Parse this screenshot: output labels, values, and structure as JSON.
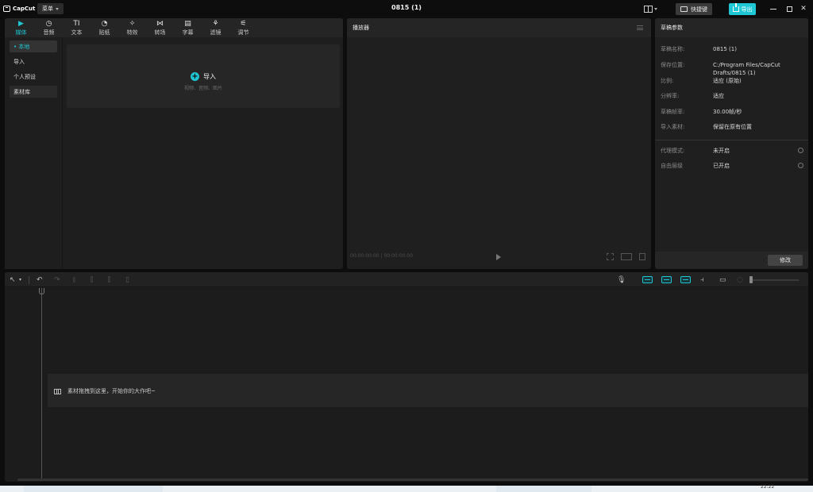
{
  "titlebar": {
    "logo_text": "CapCut",
    "menu_label": "菜单",
    "title": "0815 (1)",
    "shortcuts_label": "快捷键",
    "export_label": "导出"
  },
  "media_tabs": [
    {
      "label": "媒体",
      "icon": "media-icon",
      "glyph": "▶"
    },
    {
      "label": "音频",
      "icon": "audio-icon",
      "glyph": "◷"
    },
    {
      "label": "文本",
      "icon": "text-icon",
      "glyph": "TI"
    },
    {
      "label": "贴纸",
      "icon": "sticker-icon",
      "glyph": "◔"
    },
    {
      "label": "特效",
      "icon": "effects-icon",
      "glyph": "✧"
    },
    {
      "label": "转场",
      "icon": "transition-icon",
      "glyph": "⋈"
    },
    {
      "label": "字幕",
      "icon": "captions-icon",
      "glyph": "▤"
    },
    {
      "label": "滤镜",
      "icon": "filter-icon",
      "glyph": "⚘"
    },
    {
      "label": "调节",
      "icon": "adjust-icon",
      "glyph": "⚟"
    }
  ],
  "media_sidebar": [
    {
      "label": "• 本地"
    },
    {
      "label": "导入"
    },
    {
      "label": "个人预设"
    },
    {
      "label": "素材库"
    }
  ],
  "import_zone": {
    "label": "导入",
    "hint": "视频、音频、图片"
  },
  "player": {
    "title": "播放器",
    "timecode": "00:00:00:00 | 00:00:00:00"
  },
  "draft": {
    "title": "草稿参数",
    "rows": [
      {
        "key": "草稿名称:",
        "value": "0815 (1)"
      },
      {
        "key": "保存位置:",
        "value": "C:/Program Files/CapCut Drafts/0815 (1)"
      },
      {
        "key": "比例:",
        "value": "适应 (原始)"
      },
      {
        "key": "分辨率:",
        "value": "适应"
      },
      {
        "key": "草稿帧率:",
        "value": "30.00帧/秒"
      },
      {
        "key": "导入素材:",
        "value": "保留在原有位置"
      }
    ],
    "rows2": [
      {
        "key": "代理模式:",
        "value": "未开启"
      },
      {
        "key": "自由层级",
        "value": "已开启"
      }
    ],
    "modify_label": "修改"
  },
  "timeline": {
    "hint": "素材拖拽到这里，开始你的大作吧~"
  },
  "taskbar": {
    "clock": "22:22"
  },
  "colors": {
    "accent": "#1fc7d4",
    "panel": "#1f1f1f",
    "background": "#0d0d0d"
  }
}
